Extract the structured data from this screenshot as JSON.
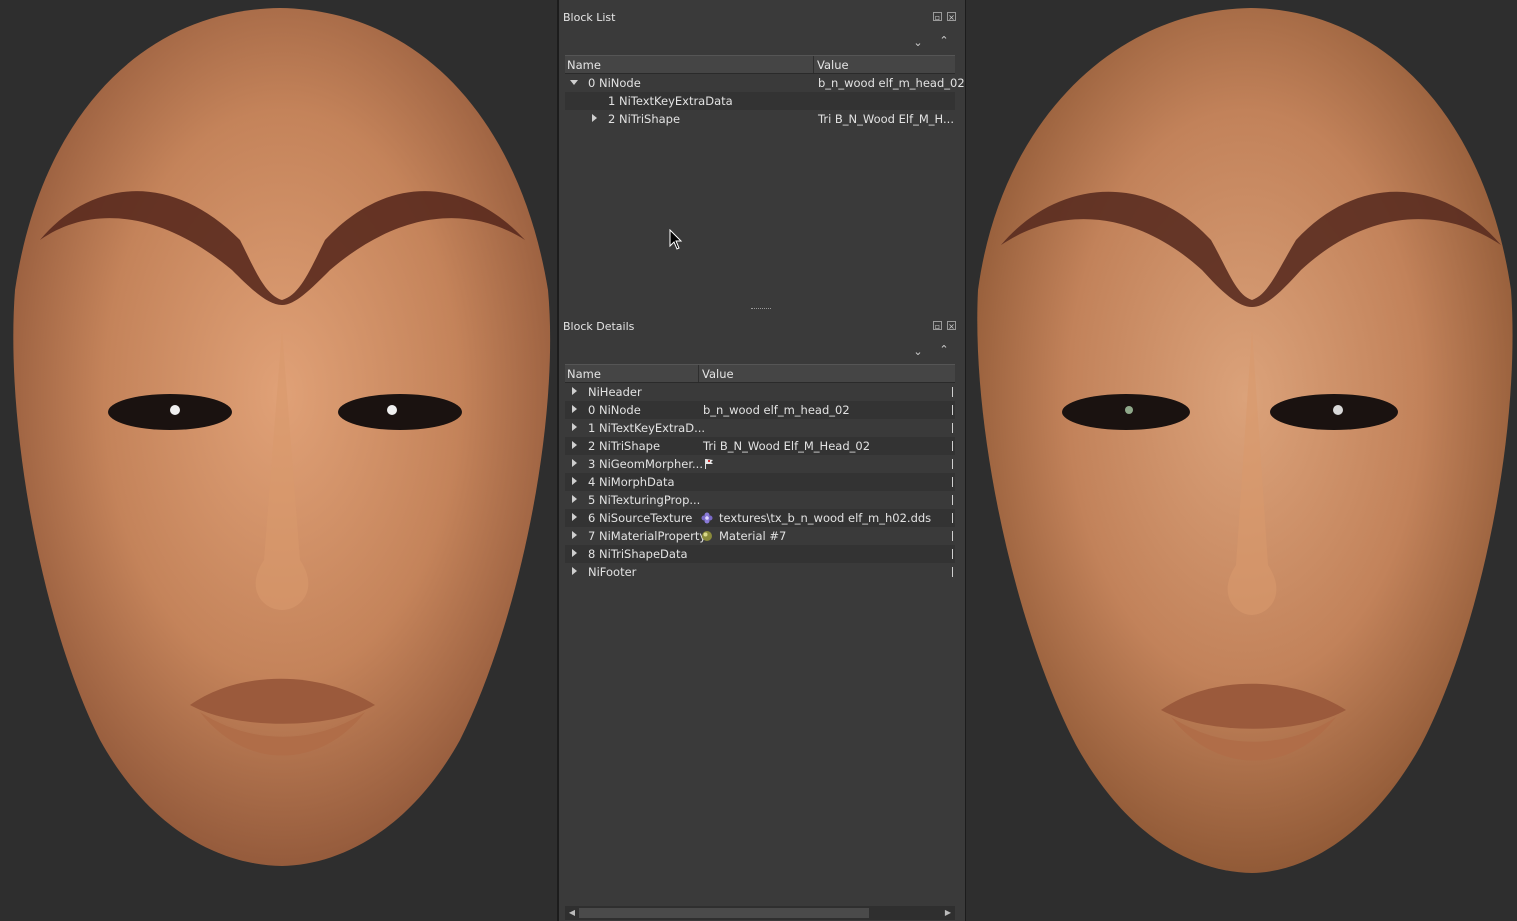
{
  "block_list": {
    "title": "Block List",
    "columns": [
      "Name",
      "Value"
    ],
    "rows": [
      {
        "name": "0 NiNode",
        "value": "b_n_wood elf_m_head_02"
      },
      {
        "name": "1 NiTextKeyExtraData",
        "value": ""
      },
      {
        "name": "2 NiTriShape",
        "value": "Tri B_N_Wood Elf_M_H..."
      }
    ]
  },
  "block_details": {
    "title": "Block Details",
    "columns": [
      "Name",
      "Value"
    ],
    "rows": [
      {
        "name": "NiHeader",
        "value": "",
        "icon": ""
      },
      {
        "name": "0 NiNode",
        "value": "b_n_wood elf_m_head_02",
        "icon": ""
      },
      {
        "name": "1 NiTextKeyExtraD...",
        "value": "",
        "icon": ""
      },
      {
        "name": "2 NiTriShape",
        "value": "Tri B_N_Wood Elf_M_Head_02",
        "icon": ""
      },
      {
        "name": "3 NiGeomMorpher...",
        "value": "",
        "icon": "flag-icon"
      },
      {
        "name": "4 NiMorphData",
        "value": "",
        "icon": ""
      },
      {
        "name": "5 NiTexturingProp...",
        "value": "",
        "icon": ""
      },
      {
        "name": "6 NiSourceTexture",
        "value": "textures\\tx_b_n_wood elf_m_h02.dds",
        "icon": "texture-flower-icon"
      },
      {
        "name": "7 NiMaterialProperty",
        "value": "Material #7",
        "icon": "material-sphere-icon"
      },
      {
        "name": "8 NiTriShapeData",
        "value": "",
        "icon": ""
      },
      {
        "name": "NiFooter",
        "value": "",
        "icon": ""
      }
    ]
  },
  "colors": {
    "panel": "#3a3a3a",
    "viewport": "#2e2e2e",
    "skin": "#c98a5c"
  }
}
